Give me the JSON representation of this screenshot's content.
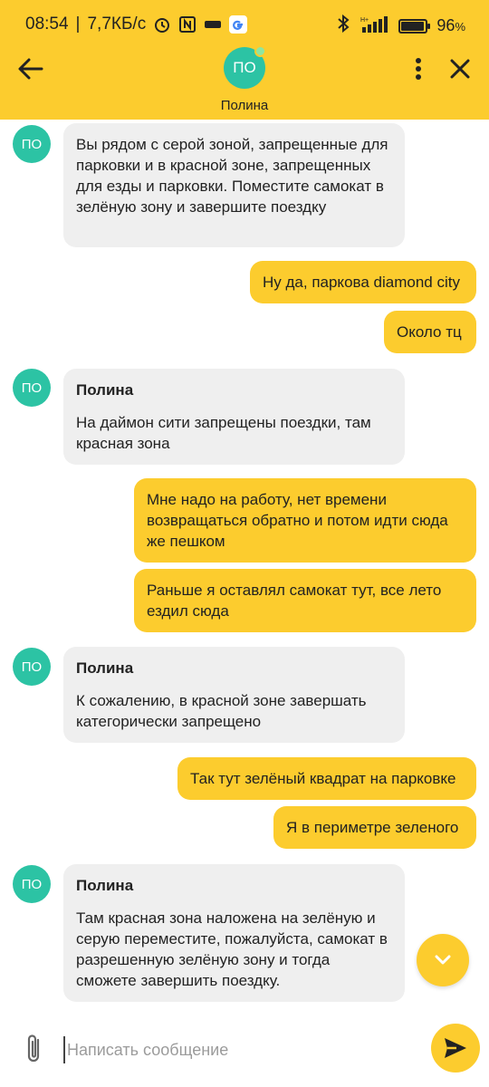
{
  "status_bar": {
    "time": "08:54",
    "speed": "7,7КБ/с",
    "battery": "96",
    "battery_unit": "%",
    "battery_level": 0.96,
    "icons": [
      "alarm-icon",
      "nfc-icon",
      "operator-icon",
      "google-icon",
      "bluetooth-icon",
      "signal-icon",
      "battery-icon"
    ]
  },
  "header": {
    "avatar_initials": "ПО",
    "name": "Полина",
    "icons": [
      "back-arrow-icon",
      "more-vertical-icon",
      "close-icon"
    ]
  },
  "messages": [
    {
      "side": "in",
      "avatar": "ПО",
      "text": "Вы рядом с серой зоной, запрещенные для парковки и в красной зоне, запрещенных для езды и парковки. Поместите самокат в зелёную зону и завершите поездку"
    },
    {
      "side": "out",
      "text": "Ну да, паркова diamond city"
    },
    {
      "side": "out",
      "text": "Около тц"
    },
    {
      "side": "in",
      "avatar": "ПО",
      "sender": "Полина",
      "text": "На даймон сити запрещены поездки, там красная зона"
    },
    {
      "side": "out",
      "text": "Мне надо на работу, нет времени возвращаться обратно и потом идти сюда же пешком"
    },
    {
      "side": "out",
      "text": "Раньше я оставлял самокат тут, все лето ездил сюда"
    },
    {
      "side": "in",
      "avatar": "ПО",
      "sender": "Полина",
      "text": "К сожалению, в красной зоне завершать категорически запрещено"
    },
    {
      "side": "out",
      "text": "Так тут зелёный квадрат на парковке"
    },
    {
      "side": "out",
      "text": "Я в периметре зеленого"
    },
    {
      "side": "in",
      "avatar": "ПО",
      "sender": "Полина",
      "text": "Там красная зона наложена на зелёную и серую переместите, пожалуйста, самокат в разрешенную зелёную зону и тогда сможете завершить поездку."
    }
  ],
  "composer": {
    "placeholder": "Написать сообщение",
    "value": "",
    "icons": [
      "paperclip-icon",
      "send-icon"
    ]
  },
  "colors": {
    "accent": "#fccc2e",
    "avatar": "#2cc3a4",
    "incoming_bubble": "#efefef"
  }
}
